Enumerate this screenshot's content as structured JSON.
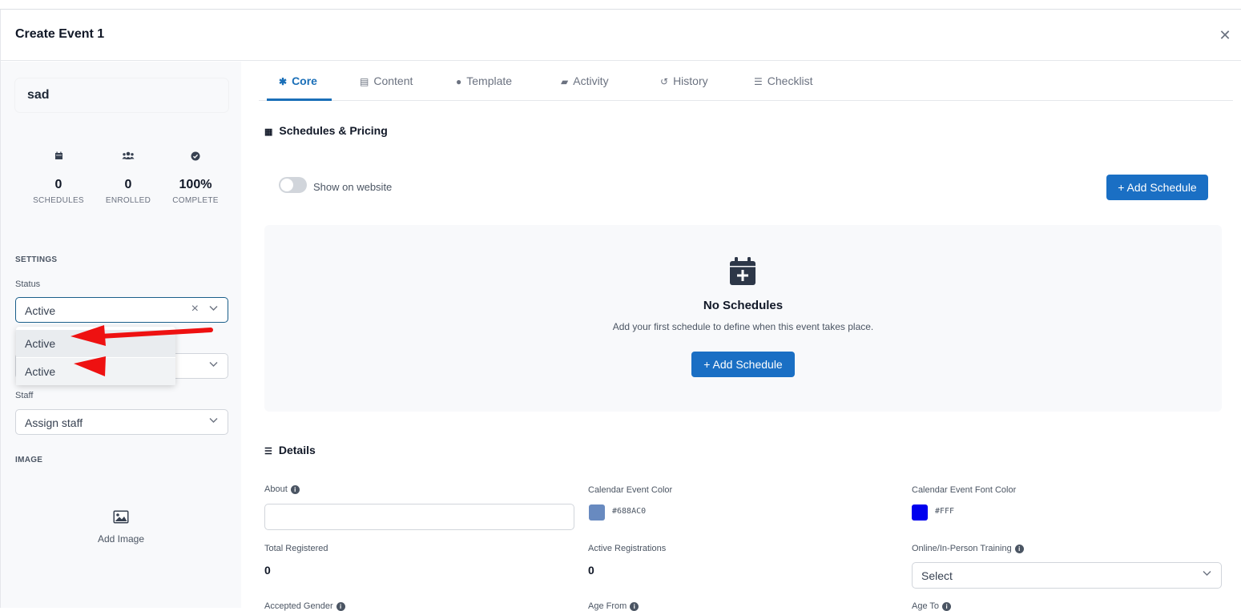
{
  "modal": {
    "title": "Create Event 1"
  },
  "sidebar": {
    "event_name": "sad",
    "stats": [
      {
        "icon": "calendar-icon",
        "value": "0",
        "label": "SCHEDULES"
      },
      {
        "icon": "users-icon",
        "value": "0",
        "label": "ENROLLED"
      },
      {
        "icon": "check-circle-icon",
        "value": "100%",
        "label": "COMPLETE"
      }
    ],
    "settings_label": "SETTINGS",
    "status_label": "Status",
    "status_value": "Active",
    "status_options": [
      "Active",
      "Active"
    ],
    "staff_label": "Staff",
    "staff_placeholder": "Assign staff",
    "image_label": "IMAGE",
    "add_image_label": "Add Image"
  },
  "tabs": [
    {
      "label": "Core",
      "icon": "gear-icon",
      "active": true
    },
    {
      "label": "Content",
      "icon": "file-icon"
    },
    {
      "label": "Template",
      "icon": "palette-icon"
    },
    {
      "label": "Activity",
      "icon": "comments-icon"
    },
    {
      "label": "History",
      "icon": "history-icon"
    },
    {
      "label": "Checklist",
      "icon": "checklist-icon"
    }
  ],
  "schedules": {
    "heading": "Schedules & Pricing",
    "show_on_website_label": "Show on website",
    "show_on_website": false,
    "add_schedule_label": "+ Add Schedule",
    "empty_title": "No Schedules",
    "empty_desc": "Add your first schedule to define when this event takes place.",
    "empty_button_label": "+ Add Schedule"
  },
  "details": {
    "heading": "Details",
    "about_label": "About",
    "about_value": "",
    "cal_color_label": "Calendar Event Color",
    "cal_color_hex": "#688AC0",
    "cal_font_color_label": "Calendar Event Font Color",
    "cal_font_color_hex": "#FFF",
    "font_swatch_color": "#0000ee",
    "total_registered_label": "Total Registered",
    "total_registered": "0",
    "active_reg_label": "Active Registrations",
    "active_reg": "0",
    "training_label": "Online/In-Person Training",
    "training_placeholder": "Select",
    "gender_label": "Accepted Gender",
    "age_from_label": "Age From",
    "age_to_label": "Age To"
  },
  "colors": {
    "accent": "#1a6fc4",
    "annotation_arrow": "#ee1111"
  }
}
